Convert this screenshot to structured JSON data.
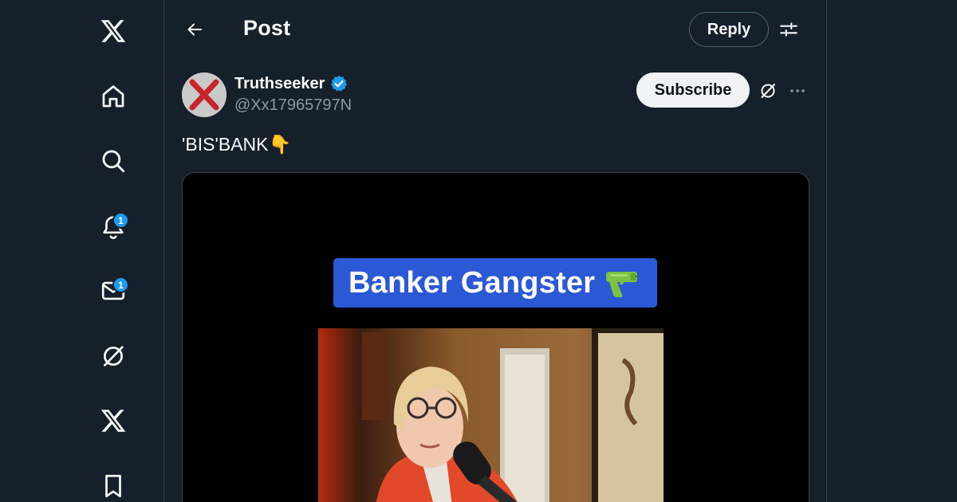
{
  "nav": {
    "notifications_badge": "1",
    "messages_badge": "1"
  },
  "header": {
    "title": "Post",
    "reply_label": "Reply"
  },
  "post": {
    "author": {
      "display_name": "Truthseeker",
      "handle": "@Xx17965797N"
    },
    "subscribe_label": "Subscribe",
    "text": "'BIS'BANK👇",
    "media": {
      "caption": "Banker Gangster"
    }
  },
  "colors": {
    "background": "#15202b",
    "accent": "#1d9bf0",
    "caption_bg": "#2b58d4"
  }
}
